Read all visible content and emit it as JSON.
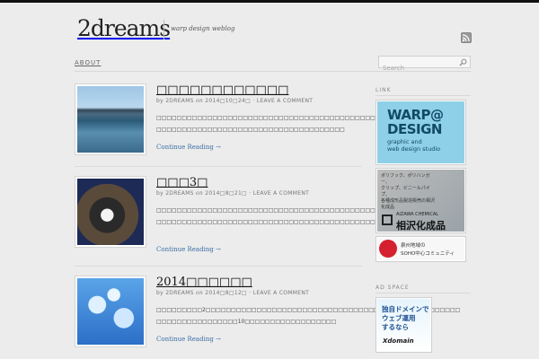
{
  "site": {
    "logo_text": "2dreams",
    "tagline": "warp design weblog"
  },
  "nav": {
    "about_label": "ABOUT",
    "search_placeholder": "Search"
  },
  "posts": [
    {
      "title": "□□□□□□□□□□□□",
      "date": "2014□10□24□",
      "comment_link": "LEAVE A COMMENT",
      "excerpt": "□□□□□□□□□□□□□□□□□□□□□□□□□□□□□□□□□□□□□□□□□□□□□□□□□□□□□□□□□□□□□□□□□□□□□□□□□□□□□□□□□□□□□□□□□□□□□□□□□",
      "read_more": "Continue Reading →",
      "thumbnail": "lake-photo"
    },
    {
      "title": "□□□3□",
      "date": "2014□8□21□",
      "comment_link": "LEAVE A COMMENT",
      "excerpt": "□□□□□□□□□□□□□□□□□□□□□□□□□□□□□□□□□□□□□□□□□□□□□□□□□□□□□□□□□□□□□□□□□□□□□□□□□□□□□□□□□□□□□□□□□□□□□□□□□□□□□□□□□□",
      "read_more": "Continue Reading →",
      "thumbnail": "dog-photo"
    },
    {
      "title": "2014□□□□□□",
      "date": "2014□8□12□",
      "comment_link": "LEAVE A COMMENT",
      "excerpt": "□□□□□□□□□2□□□□□□□□□□□□□□□□□□□□□□□□□□□□□□□□□□□□□□□□□□□□□□□□□□□□□□□□□□□□□□□□□□10□□□□□□□□□□□□□□□□□□",
      "read_more": "Continue Reading →",
      "thumbnail": "jellyfish-photo"
    }
  ],
  "post_meta": {
    "by_label": "by",
    "author": "2DREAMS",
    "on_label": "on",
    "separator": "·"
  },
  "sidebar": {
    "link_title": "LINK",
    "ad_title": "AD SPACE",
    "banners": {
      "warp": {
        "line1": "WARP@",
        "line2": "DESIGN",
        "sub1": "graphic and",
        "sub2": "web design studio"
      },
      "aizawa": {
        "small1": "ポリフック、ポリハンガー、",
        "small2": "クリップ、ビニールパイプ、",
        "small3": "各種成形品製造販売の相沢化成品",
        "name_en": "AIZAWA CHEMICAL",
        "name_jp": "相沢化成品"
      },
      "soho": {
        "line1": "泉州地域の",
        "line2": "SOHO中心コミュニティ"
      },
      "ad": {
        "line1": "独自ドメインで",
        "line2": "ウェブ運用",
        "line3": "するなら",
        "brand": "Xdomain"
      }
    }
  },
  "colors": {
    "background": "#ececec",
    "link": "#3a6ea5",
    "warp_banner": "#8ed0e8",
    "soho_red": "#d4202f"
  }
}
